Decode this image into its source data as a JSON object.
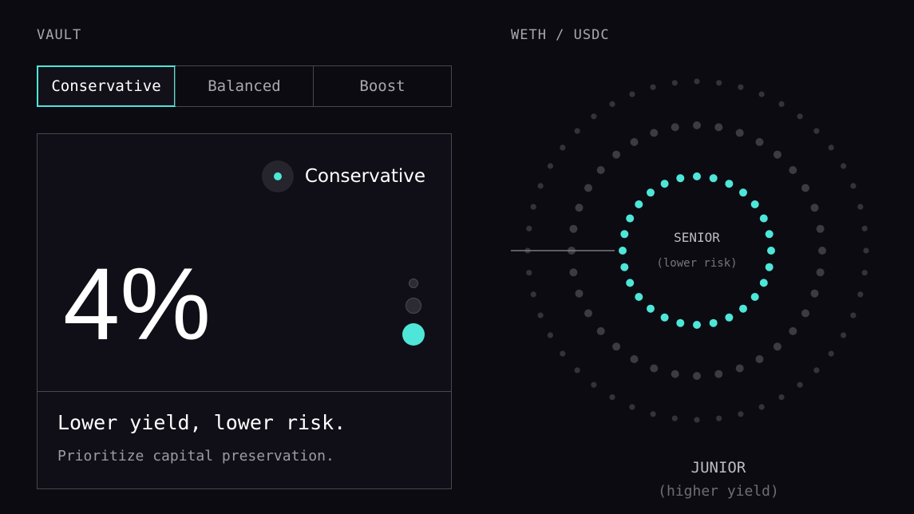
{
  "vault": {
    "section_label": "VAULT",
    "tabs": [
      {
        "label": "Conservative",
        "active": true
      },
      {
        "label": "Balanced",
        "active": false
      },
      {
        "label": "Boost",
        "active": false
      }
    ],
    "card": {
      "badge_label": "Conservative",
      "badge_icon": "dot-icon",
      "yield_value": "4%",
      "risk_level": 1,
      "risk_levels_total": 3,
      "headline": "Lower yield, lower risk.",
      "description": "Prioritize capital preservation."
    }
  },
  "pair": {
    "section_label": "WETH / USDC",
    "senior": {
      "label": "SENIOR",
      "sub": "(lower risk)"
    },
    "junior": {
      "label": "JUNIOR",
      "sub": "(higher yield)"
    }
  },
  "colors": {
    "accent": "#4ee6d8",
    "background": "#0c0b12",
    "border": "#48474f",
    "muted_text": "#a9a8b0",
    "dim_dots": "#3a3942"
  }
}
